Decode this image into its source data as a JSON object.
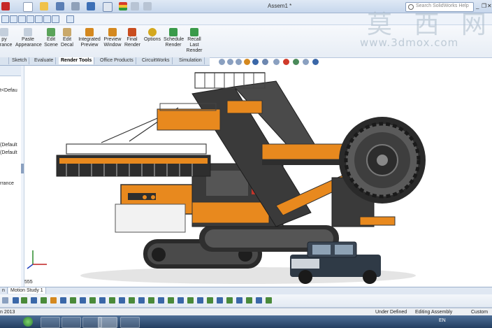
{
  "window": {
    "title": "Assem1 *",
    "search_placeholder": "Search SolidWorks Help",
    "controls": [
      "_",
      "❐",
      "✕"
    ]
  },
  "ribbon": {
    "buttons": [
      {
        "line1": "py",
        "line2": "arance",
        "icon": "copy-appearance-icon"
      },
      {
        "line1": "Paste",
        "line2": "Appearance",
        "icon": "paste-appearance-icon"
      },
      {
        "line1": "Edit",
        "line2": "Scene",
        "icon": "edit-scene-icon"
      },
      {
        "line1": "Edit",
        "line2": "Decal",
        "icon": "edit-decal-icon"
      },
      {
        "line1": "Integrated",
        "line2": "Preview",
        "icon": "integrated-preview-icon"
      },
      {
        "line1": "Preview",
        "line2": "Window",
        "icon": "preview-window-icon"
      },
      {
        "line1": "Final",
        "line2": "Render",
        "icon": "final-render-icon"
      },
      {
        "line1": "Options",
        "line2": "",
        "icon": "options-icon"
      },
      {
        "line1": "Schedule",
        "line2": "Render",
        "icon": "schedule-render-icon"
      },
      {
        "line1": "Recall",
        "line2": "Last",
        "line3": "Render",
        "icon": "recall-last-render-icon"
      }
    ]
  },
  "tabs": [
    "Sketch",
    "Evaluate",
    "Render Tools",
    "Office Products",
    "CircuitWorks",
    "Simulation"
  ],
  "active_tab": "Render Tools",
  "tree": {
    "items": [
      "t<Defau",
      "(Default",
      "(Default",
      "rrance"
    ]
  },
  "viewport": {
    "scale_label": "555",
    "triad_axes": [
      "Y",
      "X",
      "Z"
    ]
  },
  "bottom_tabs": [
    "n",
    "Motion Study 1"
  ],
  "status": {
    "left": "n 2013",
    "state": "Under Defined",
    "mode": "Editing Assembly",
    "units": "Custom"
  },
  "taskbar": {
    "language": "EN"
  },
  "watermark": {
    "cn": "莫 西 网",
    "url": "www.3dmox.com"
  },
  "colors": {
    "machine_orange": "#e8891e",
    "machine_dark": "#2e2e2e",
    "accent_blue": "#3a67a8"
  }
}
